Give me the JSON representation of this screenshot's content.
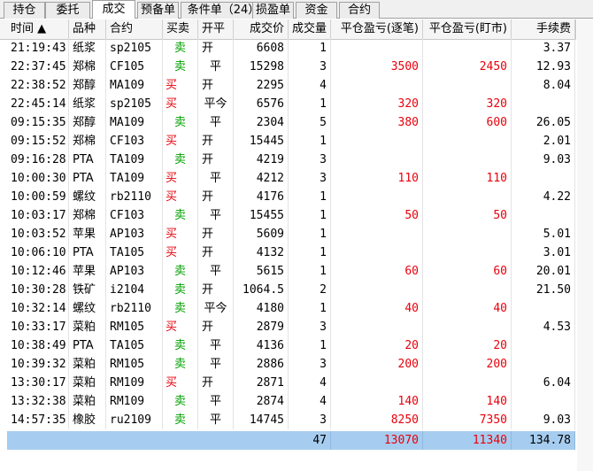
{
  "tabs": [
    "持仓",
    "委托",
    "成交",
    "预备单",
    "条件单（24）",
    "损盈单",
    "资金",
    "合约"
  ],
  "active_tab": 2,
  "columns": [
    "时间 ▲",
    "品种",
    "合约",
    "买卖",
    "开平",
    "成交价",
    "成交量",
    "平仓盈亏(逐笔)",
    "平仓盈亏(盯市)",
    "手续费"
  ],
  "rows": [
    {
      "time": "21:19:43",
      "variety": "纸浆",
      "contract": "sp2105",
      "side": "卖",
      "open_close": "开",
      "price": "6608",
      "qty": "1",
      "pnl_trade": "",
      "pnl_mark": "",
      "fee": "3.37"
    },
    {
      "time": "22:37:45",
      "variety": "郑棉",
      "contract": "CF105",
      "side": "卖",
      "open_close": "平",
      "price": "15298",
      "qty": "3",
      "pnl_trade": "3500",
      "pnl_mark": "2450",
      "fee": "12.93"
    },
    {
      "time": "22:38:52",
      "variety": "郑醇",
      "contract": "MA109",
      "side": "买",
      "open_close": "开",
      "price": "2295",
      "qty": "4",
      "pnl_trade": "",
      "pnl_mark": "",
      "fee": "8.04"
    },
    {
      "time": "22:45:14",
      "variety": "纸浆",
      "contract": "sp2105",
      "side": "买",
      "open_close": "平今",
      "price": "6576",
      "qty": "1",
      "pnl_trade": "320",
      "pnl_mark": "320",
      "fee": ""
    },
    {
      "time": "09:15:35",
      "variety": "郑醇",
      "contract": "MA109",
      "side": "卖",
      "open_close": "平",
      "price": "2304",
      "qty": "5",
      "pnl_trade": "380",
      "pnl_mark": "600",
      "fee": "26.05"
    },
    {
      "time": "09:15:52",
      "variety": "郑棉",
      "contract": "CF103",
      "side": "买",
      "open_close": "开",
      "price": "15445",
      "qty": "1",
      "pnl_trade": "",
      "pnl_mark": "",
      "fee": "2.01"
    },
    {
      "time": "09:16:28",
      "variety": "PTA",
      "contract": "TA109",
      "side": "卖",
      "open_close": "开",
      "price": "4219",
      "qty": "3",
      "pnl_trade": "",
      "pnl_mark": "",
      "fee": "9.03"
    },
    {
      "time": "10:00:30",
      "variety": "PTA",
      "contract": "TA109",
      "side": "买",
      "open_close": "平",
      "price": "4212",
      "qty": "3",
      "pnl_trade": "110",
      "pnl_mark": "110",
      "fee": ""
    },
    {
      "time": "10:00:59",
      "variety": "螺纹",
      "contract": "rb2110",
      "side": "买",
      "open_close": "开",
      "price": "4176",
      "qty": "1",
      "pnl_trade": "",
      "pnl_mark": "",
      "fee": "4.22"
    },
    {
      "time": "10:03:17",
      "variety": "郑棉",
      "contract": "CF103",
      "side": "卖",
      "open_close": "平",
      "price": "15455",
      "qty": "1",
      "pnl_trade": "50",
      "pnl_mark": "50",
      "fee": ""
    },
    {
      "time": "10:03:52",
      "variety": "苹果",
      "contract": "AP103",
      "side": "买",
      "open_close": "开",
      "price": "5609",
      "qty": "1",
      "pnl_trade": "",
      "pnl_mark": "",
      "fee": "5.01"
    },
    {
      "time": "10:06:10",
      "variety": "PTA",
      "contract": "TA105",
      "side": "买",
      "open_close": "开",
      "price": "4132",
      "qty": "1",
      "pnl_trade": "",
      "pnl_mark": "",
      "fee": "3.01"
    },
    {
      "time": "10:12:46",
      "variety": "苹果",
      "contract": "AP103",
      "side": "卖",
      "open_close": "平",
      "price": "5615",
      "qty": "1",
      "pnl_trade": "60",
      "pnl_mark": "60",
      "fee": "20.01"
    },
    {
      "time": "10:30:28",
      "variety": "铁矿",
      "contract": "i2104",
      "side": "卖",
      "open_close": "开",
      "price": "1064.5",
      "qty": "2",
      "pnl_trade": "",
      "pnl_mark": "",
      "fee": "21.50"
    },
    {
      "time": "10:32:14",
      "variety": "螺纹",
      "contract": "rb2110",
      "side": "卖",
      "open_close": "平今",
      "price": "4180",
      "qty": "1",
      "pnl_trade": "40",
      "pnl_mark": "40",
      "fee": ""
    },
    {
      "time": "10:33:17",
      "variety": "菜粕",
      "contract": "RM105",
      "side": "买",
      "open_close": "开",
      "price": "2879",
      "qty": "3",
      "pnl_trade": "",
      "pnl_mark": "",
      "fee": "4.53"
    },
    {
      "time": "10:38:49",
      "variety": "PTA",
      "contract": "TA105",
      "side": "卖",
      "open_close": "平",
      "price": "4136",
      "qty": "1",
      "pnl_trade": "20",
      "pnl_mark": "20",
      "fee": ""
    },
    {
      "time": "10:39:32",
      "variety": "菜粕",
      "contract": "RM105",
      "side": "卖",
      "open_close": "平",
      "price": "2886",
      "qty": "3",
      "pnl_trade": "200",
      "pnl_mark": "200",
      "fee": ""
    },
    {
      "time": "13:30:17",
      "variety": "菜粕",
      "contract": "RM109",
      "side": "买",
      "open_close": "开",
      "price": "2871",
      "qty": "4",
      "pnl_trade": "",
      "pnl_mark": "",
      "fee": "6.04"
    },
    {
      "time": "13:32:38",
      "variety": "菜粕",
      "contract": "RM109",
      "side": "卖",
      "open_close": "平",
      "price": "2874",
      "qty": "4",
      "pnl_trade": "140",
      "pnl_mark": "140",
      "fee": ""
    },
    {
      "time": "14:57:35",
      "variety": "橡胶",
      "contract": "ru2109",
      "side": "卖",
      "open_close": "平",
      "price": "14745",
      "qty": "3",
      "pnl_trade": "8250",
      "pnl_mark": "7350",
      "fee": "9.03"
    }
  ],
  "totals": {
    "qty": "47",
    "pnl_trade": "13070",
    "pnl_mark": "11340",
    "fee": "134.78"
  },
  "colors": {
    "buy": "#e8000b",
    "sell": "#00a000",
    "pnl": "#e8000b",
    "total_row": "#a6cdef"
  }
}
